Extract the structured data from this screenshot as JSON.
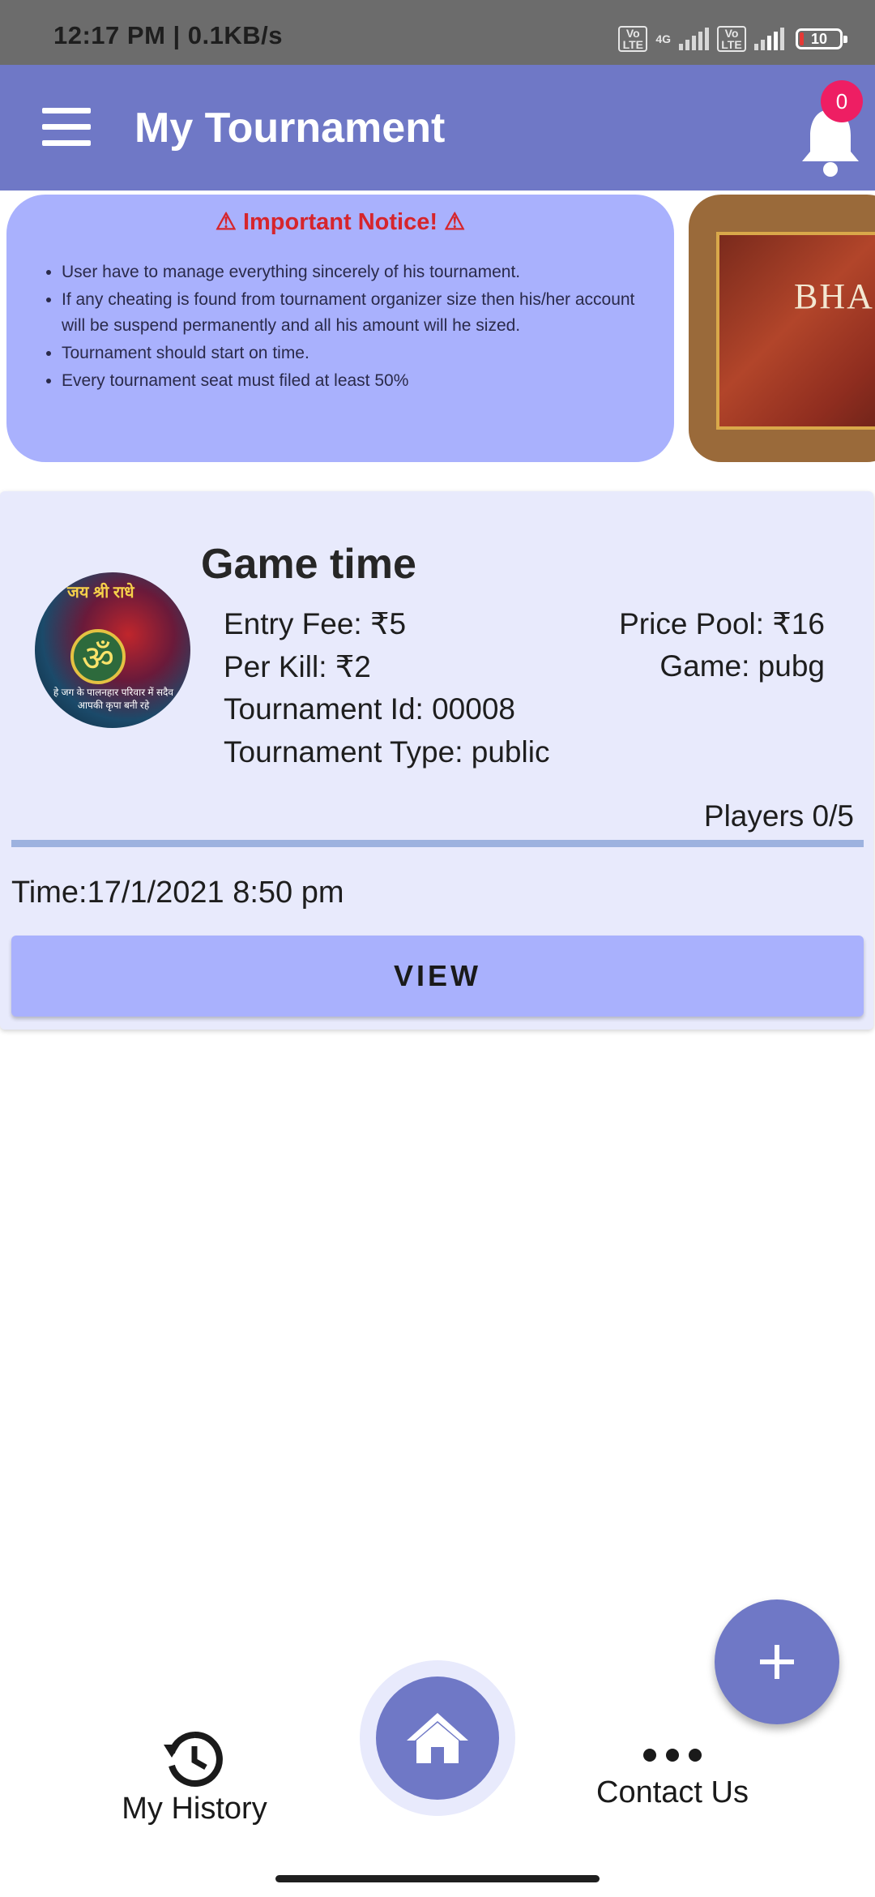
{
  "status_bar": {
    "time": "12:17 PM | 0.1KB/s",
    "network_tag": "4G",
    "volte": "Vo LTE",
    "battery": "10"
  },
  "app_bar": {
    "title": "My Tournament",
    "notification_count": "0"
  },
  "notice": {
    "heading": "⚠ Important Notice! ⚠",
    "items": [
      "User have to manage everything sincerely of his tournament.",
      "If any cheating is found from tournament organizer size then his/her account will be suspend permanently and all his amount will he sized.",
      "Tournament should start on time.",
      "Every tournament seat must filed at least 50%"
    ],
    "second_banner_text": "BHA"
  },
  "tournament": {
    "avatar_text_top": "जय श्री राधे",
    "avatar_text_bottom": "हे जग के पालनहार परिवार में सदैव आपकी कृपा बनी रहे",
    "name": "Game time",
    "entry_fee": "Entry Fee: ₹5",
    "per_kill": "Per Kill: ₹2",
    "tournament_id": "Tournament Id: 00008",
    "tournament_type": "Tournament Type: public",
    "price_pool": "Price Pool: ₹16",
    "game": "Game: pubg",
    "players": "Players 0/5",
    "players_joined": 0,
    "players_total": 5,
    "time": "Time:17/1/2021 8:50 pm",
    "view_label": "VIEW"
  },
  "bottom_nav": {
    "history_label": "My History",
    "contact_label": "Contact Us"
  },
  "colors": {
    "primary": "#6f78c6",
    "accent_light": "#a9b1fd",
    "card_bg": "#e8eafc",
    "badge": "#ee1e63"
  }
}
